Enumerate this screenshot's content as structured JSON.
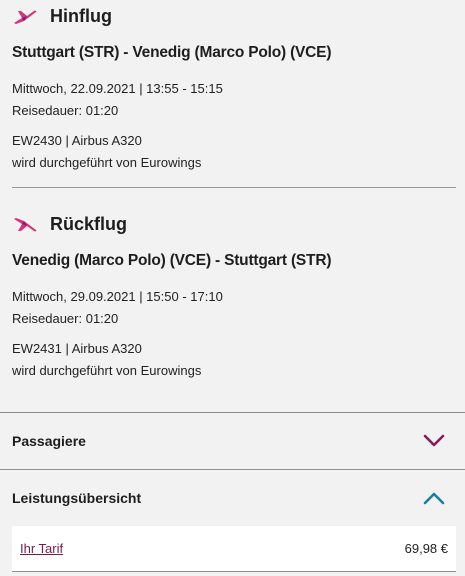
{
  "outbound": {
    "title": "Hinflug",
    "route": "Stuttgart (STR) - Venedig (Marco Polo) (VCE)",
    "datetime": "Mittwoch, 22.09.2021 | 13:55 - 15:15",
    "duration": "Reisedauer: 01:20",
    "flight": "EW2430 | Airbus A320",
    "operator": "wird durchgeführt von Eurowings",
    "icon": "plane-departure-icon"
  },
  "return": {
    "title": "Rückflug",
    "route": "Venedig (Marco Polo) (VCE) - Stuttgart (STR)",
    "datetime": "Mittwoch, 29.09.2021 | 15:50 - 17:10",
    "duration": "Reisedauer: 01:20",
    "flight": "EW2431 | Airbus A320",
    "operator": "wird durchgeführt von Eurowings",
    "icon": "plane-arrival-icon"
  },
  "sections": {
    "passengers": {
      "label": "Passagiere",
      "state": "collapsed"
    },
    "services": {
      "label": "Leistungsübersicht",
      "state": "expanded"
    }
  },
  "tariff": {
    "label": "Ihr Tarif",
    "price": "69,98 €"
  },
  "colors": {
    "accent_magenta": "#8b1a5a",
    "accent_teal": "#1a7fa0",
    "plane_pink": "#d6337a",
    "plane_purple": "#6a2a6a"
  }
}
